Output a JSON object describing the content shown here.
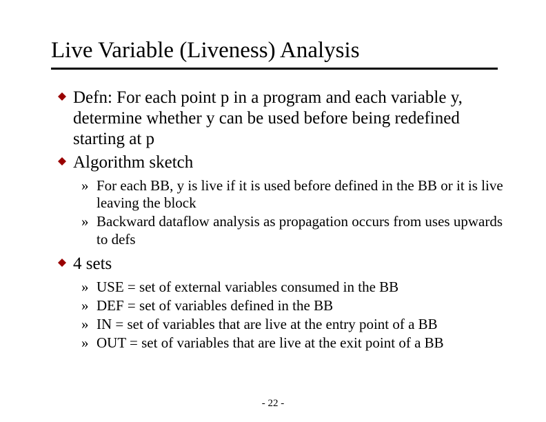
{
  "title": "Live Variable (Liveness) Analysis",
  "bullets": {
    "defn": "Defn: For each point p in a program and each variable y, determine whether y can be used before being redefined starting at p",
    "algo": "Algorithm sketch",
    "algo_sub": {
      "a": "For each BB, y is live if it is used before defined in the BB or it is live leaving the block",
      "b": "Backward dataflow analysis as propagation occurs from uses upwards to defs"
    },
    "sets": "4 sets",
    "sets_sub": {
      "a": "USE = set of external variables consumed in the BB",
      "b": "DEF = set of variables defined in the BB",
      "c": "IN = set of variables that are live at the entry point of a BB",
      "d": "OUT = set of variables that are live at the exit point of a BB"
    }
  },
  "footer": "- 22 -"
}
